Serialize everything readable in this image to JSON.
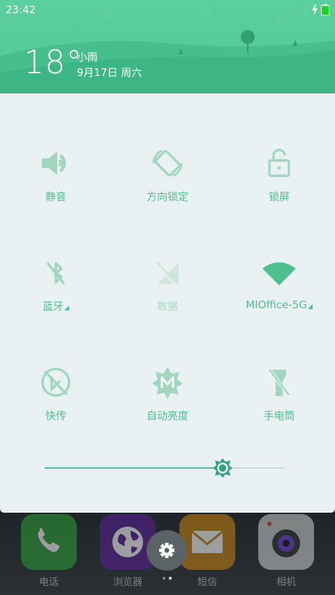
{
  "status_bar": {
    "time": "23:42",
    "charging_icon": "bolt-icon",
    "battery_icon": "battery-icon",
    "battery_color": "#1dd31d"
  },
  "weather": {
    "temperature": "18°",
    "condition": "小雨",
    "date": "9月17日 周六"
  },
  "toggles": [
    {
      "id": "mute",
      "label": "静音",
      "icon": "volume-icon",
      "active": true
    },
    {
      "id": "rotation-lock",
      "label": "方向锁定",
      "icon": "rotation-lock-icon",
      "active": true
    },
    {
      "id": "lock-screen",
      "label": "锁屏",
      "icon": "lock-icon",
      "active": true
    },
    {
      "id": "bluetooth",
      "label": "蓝牙",
      "icon": "bluetooth-off-icon",
      "active": true,
      "has_more": true
    },
    {
      "id": "data",
      "label": "数据",
      "icon": "mobile-data-off-icon",
      "active": false
    },
    {
      "id": "wifi",
      "label": "MIOffice-5G",
      "icon": "wifi-icon",
      "active": true,
      "has_more": true
    },
    {
      "id": "mi-drop",
      "label": "快传",
      "icon": "mi-drop-off-icon",
      "active": true
    },
    {
      "id": "auto-brightness",
      "label": "自动亮度",
      "icon": "auto-brightness-icon",
      "active": true
    },
    {
      "id": "flashlight",
      "label": "手电筒",
      "icon": "flashlight-off-icon",
      "active": true
    }
  ],
  "brightness": {
    "level": 0.74,
    "icon": "brightness-icon"
  },
  "dock": [
    {
      "label": "电话",
      "icon": "phone-icon",
      "color": "#3cb043"
    },
    {
      "label": "浏览器",
      "icon": "globe-icon",
      "color": "#7a2fc4"
    },
    {
      "label": "短信",
      "icon": "message-icon",
      "color": "#f0a21f"
    },
    {
      "label": "相机",
      "icon": "camera-icon",
      "color": "#e8e8e8"
    }
  ],
  "settings_button": {
    "icon": "gear-icon"
  },
  "colors": {
    "accent": "#4fbf90",
    "header": "#55cb99",
    "panel": "#eaf1f2"
  }
}
